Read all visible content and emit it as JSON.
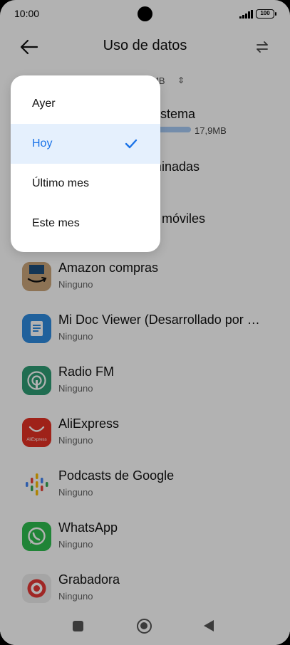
{
  "status_bar": {
    "time": "10:00",
    "battery": "100"
  },
  "header": {
    "title": "Uso de datos"
  },
  "summary": {
    "total_suffix": "MB",
    "system_label": "sistema",
    "system_usage": "17,9MB",
    "removed_label": "minadas",
    "mobile_label": "o móviles"
  },
  "apps": [
    {
      "name": "Amazon compras",
      "usage": "Ninguno",
      "icon": "amazon-icon"
    },
    {
      "name": "Mi Doc Viewer (Desarrollado por WPS Office)",
      "usage": "Ninguno",
      "icon": "doc-viewer-icon"
    },
    {
      "name": "Radio FM",
      "usage": "Ninguno",
      "icon": "radio-icon"
    },
    {
      "name": "AliExpress",
      "usage": "Ninguno",
      "icon": "aliexpress-icon",
      "icon_text": "AliExpress"
    },
    {
      "name": "Podcasts de Google",
      "usage": "Ninguno",
      "icon": "podcasts-icon"
    },
    {
      "name": "WhatsApp",
      "usage": "Ninguno",
      "icon": "whatsapp-icon"
    },
    {
      "name": "Grabadora",
      "usage": "Ninguno",
      "icon": "recorder-icon"
    }
  ],
  "period_menu": {
    "items": [
      {
        "label": "Ayer",
        "selected": false
      },
      {
        "label": "Hoy",
        "selected": true
      },
      {
        "label": "Último mes",
        "selected": false
      },
      {
        "label": "Este mes",
        "selected": false
      }
    ]
  },
  "colors": {
    "accent": "#1a73e8",
    "selected_bg": "#e5f0fd",
    "usage_bar": "#a6cbf5"
  }
}
